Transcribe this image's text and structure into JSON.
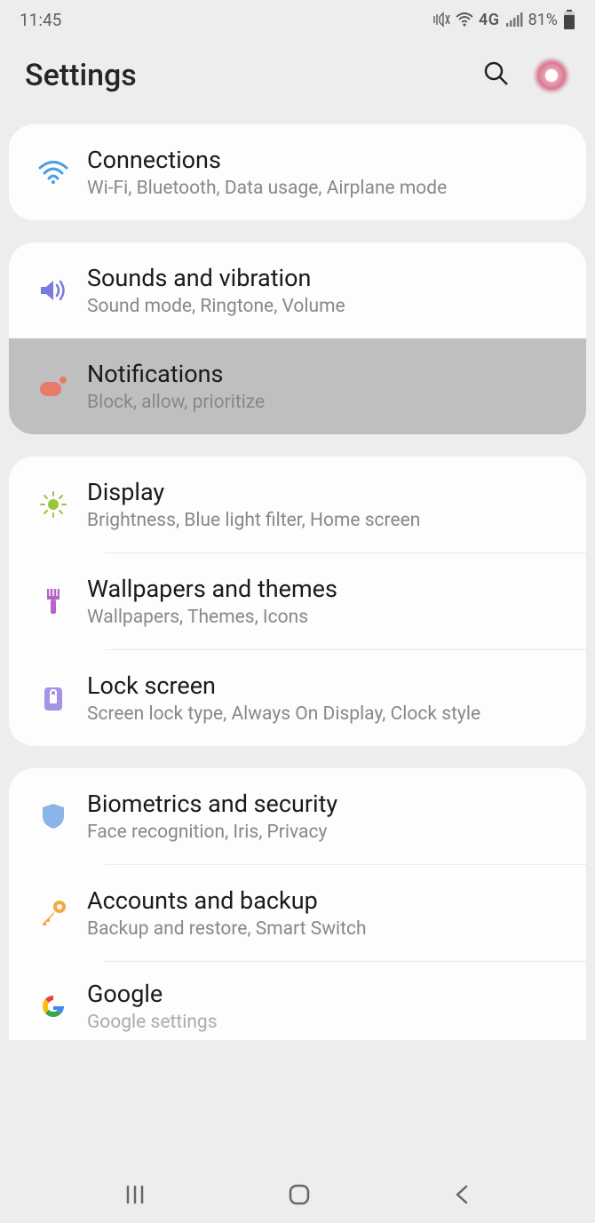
{
  "status": {
    "time": "11:45",
    "network_label": "4G",
    "battery_percent": "81%"
  },
  "header": {
    "title": "Settings"
  },
  "groups": [
    {
      "items": [
        {
          "title": "Connections",
          "subtitle": "Wi-Fi, Bluetooth, Data usage, Airplane mode"
        }
      ]
    },
    {
      "items": [
        {
          "title": "Sounds and vibration",
          "subtitle": "Sound mode, Ringtone, Volume"
        },
        {
          "title": "Notifications",
          "subtitle": "Block, allow, prioritize"
        }
      ]
    },
    {
      "items": [
        {
          "title": "Display",
          "subtitle": "Brightness, Blue light filter, Home screen"
        },
        {
          "title": "Wallpapers and themes",
          "subtitle": "Wallpapers, Themes, Icons"
        },
        {
          "title": "Lock screen",
          "subtitle": "Screen lock type, Always On Display, Clock style"
        }
      ]
    },
    {
      "items": [
        {
          "title": "Biometrics and security",
          "subtitle": "Face recognition, Iris, Privacy"
        },
        {
          "title": "Accounts and backup",
          "subtitle": "Backup and restore, Smart Switch"
        },
        {
          "title": "Google",
          "subtitle": "Google settings"
        }
      ]
    }
  ]
}
